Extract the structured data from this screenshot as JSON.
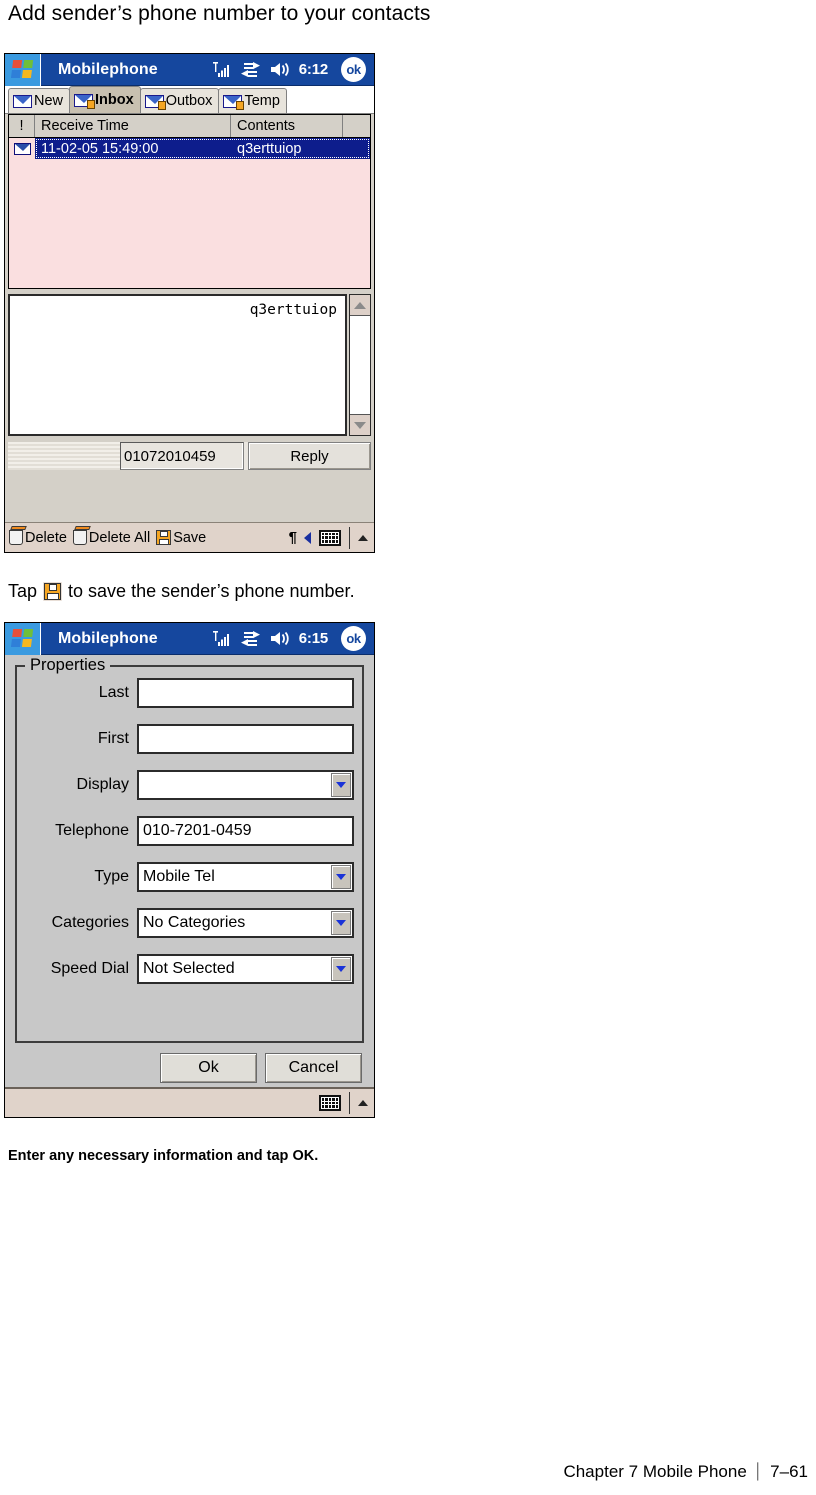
{
  "document": {
    "heading": "Add sender’s phone number to your contacts",
    "caption_tap_prefix": "Tap",
    "caption_tap_suffix": "to save the sender’s phone number.",
    "caption_bottom": "Enter any necessary information and tap OK.",
    "footer_chapter": "Chapter 7 Mobile Phone",
    "footer_separator": "│",
    "footer_page": "7–61"
  },
  "colors": {
    "titlebar_blue": "#15479e",
    "start_blue": "#3a9ae0",
    "list_pink": "#fadfe0",
    "selection_blue": "#0d1d8c",
    "dialog_gray": "#c8c8c8",
    "commandbar_tan": "#e0d3ca",
    "floppy_orange": "#f5a623"
  },
  "inbox_screen": {
    "titlebar": {
      "start_icon": "windows-logo-icon",
      "app_title": "Mobilephone",
      "signal_icon": "signal-strength-icon",
      "network_icon": "network-connection-icon",
      "volume_icon": "volume-icon",
      "clock": "6:12",
      "ok_label": "ok"
    },
    "tabs": [
      {
        "label": "New",
        "icon": "envelope-new-icon",
        "active": false
      },
      {
        "label": "Inbox",
        "icon": "envelope-inbox-icon",
        "active": true
      },
      {
        "label": "Outbox",
        "icon": "envelope-outbox-icon",
        "active": false
      },
      {
        "label": "Temp",
        "icon": "envelope-temp-icon",
        "active": false
      }
    ],
    "list": {
      "columns": [
        "!",
        "Receive Time",
        "Contents",
        ""
      ],
      "rows": [
        {
          "icon": "envelope-read-icon",
          "receive_time": "11-02-05 15:49:00",
          "contents": "q3erttuiop",
          "selected": true
        }
      ]
    },
    "message_body": {
      "text": "q3erttuiop",
      "scroll_up_icon": "scroll-up-arrow-icon",
      "scroll_down_icon": "scroll-down-arrow-icon"
    },
    "reply_row": {
      "phone_number": "01072010459",
      "reply_label": "Reply"
    },
    "commandbar": {
      "items": [
        {
          "label": "Delete",
          "icon": "trash-icon"
        },
        {
          "label": "Delete All",
          "icon": "trash-icon"
        },
        {
          "label": "Save",
          "icon": "floppy-disk-icon"
        }
      ],
      "input_panel_icon": "input-mode-icon",
      "keyboard_icon": "keyboard-icon",
      "expand_icon": "chevron-up-icon"
    }
  },
  "properties_screen": {
    "titlebar": {
      "start_icon": "windows-logo-icon",
      "app_title": "Mobilephone",
      "signal_icon": "signal-strength-icon",
      "network_icon": "network-connection-icon",
      "volume_icon": "volume-icon",
      "clock": "6:15",
      "ok_label": "ok"
    },
    "group_title": "Properties",
    "fields": [
      {
        "label": "Last",
        "value": "",
        "type": "text"
      },
      {
        "label": "First",
        "value": "",
        "type": "text"
      },
      {
        "label": "Display",
        "value": "",
        "type": "combo"
      },
      {
        "label": "Telephone",
        "value": "010-7201-0459",
        "type": "text"
      },
      {
        "label": "Type",
        "value": "Mobile Tel",
        "type": "combo"
      },
      {
        "label": "Categories",
        "value": "No Categories",
        "type": "combo"
      },
      {
        "label": "Speed Dial",
        "value": "Not Selected",
        "type": "combo"
      }
    ],
    "buttons": {
      "ok_label": "Ok",
      "cancel_label": "Cancel"
    },
    "commandbar": {
      "keyboard_icon": "keyboard-icon",
      "expand_icon": "chevron-up-icon"
    }
  }
}
